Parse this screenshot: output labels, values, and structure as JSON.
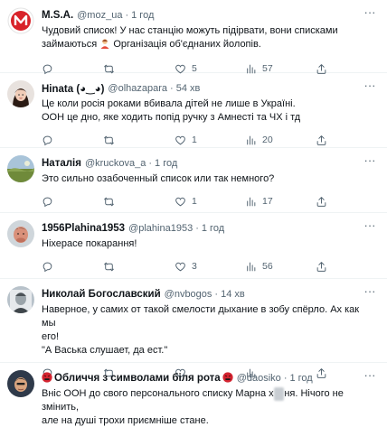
{
  "colors": {
    "text": "#0f1419",
    "muted": "#536471",
    "divider": "#eff3f4",
    "accent": "#1d9bf0"
  },
  "tweets": [
    {
      "name": "M.S.A.",
      "handle": "@moz_ua",
      "dot": "·",
      "time": "1 год",
      "lines": [
        "Чудовий список! У нас станцію можуть підірвати, вони списками",
        "займаються",
        "Організація об'єднаних йолопів."
      ],
      "reply_count": "",
      "retweet_count": "",
      "like_count": "5",
      "views_count": "57"
    },
    {
      "name": "Hinata (◕‿◕)",
      "handle": "@olhazapara",
      "dot": "·",
      "time": "54 хв",
      "lines": [
        "Це коли росія роками вбивала дітей не лише в Україні.",
        "ООН це дно, яке ходить попід ручку з Амнесті та ЧХ і тд"
      ],
      "reply_count": "",
      "retweet_count": "",
      "like_count": "1",
      "views_count": "20"
    },
    {
      "name": "Наталія",
      "handle": "@kruckova_a",
      "dot": "·",
      "time": "1 год",
      "lines": [
        "Это сильно озабоченный список или так немного?"
      ],
      "reply_count": "",
      "retweet_count": "",
      "like_count": "1",
      "views_count": "17"
    },
    {
      "name": "1956Plahina1953",
      "handle": "@plahina1953",
      "dot": "·",
      "time": "1 год",
      "lines": [
        "Ніхерасе покарання!"
      ],
      "reply_count": "",
      "retweet_count": "",
      "like_count": "3",
      "views_count": "56"
    },
    {
      "name": "Николай Богославский",
      "handle": "@nvbogos",
      "dot": "·",
      "time": "14 хв",
      "lines": [
        "Наверное, у самих от такой смелости дыхание в зобу спёрло. Ах как мы",
        "его!",
        "\"А Васька слушает, да ест.\""
      ],
      "reply_count": "",
      "retweet_count": "",
      "like_count": "",
      "views_count": ""
    },
    {
      "name": "Обличчя з символами біля рота",
      "handle": "@daosiko",
      "dot": "·",
      "time": "1 год",
      "lines": [
        "Вніс ООН до свого персонального списку Марна х",
        "ня. Нічого не змінить,",
        "але на душі трохи приємніше стане."
      ],
      "reply_count": "",
      "retweet_count": "",
      "like_count": "",
      "views_count": ""
    }
  ],
  "icons": {
    "more": "more-horizontal-icon",
    "reply": "reply-icon",
    "retweet": "retweet-icon",
    "like": "heart-icon",
    "views": "views-icon",
    "share": "share-icon"
  }
}
